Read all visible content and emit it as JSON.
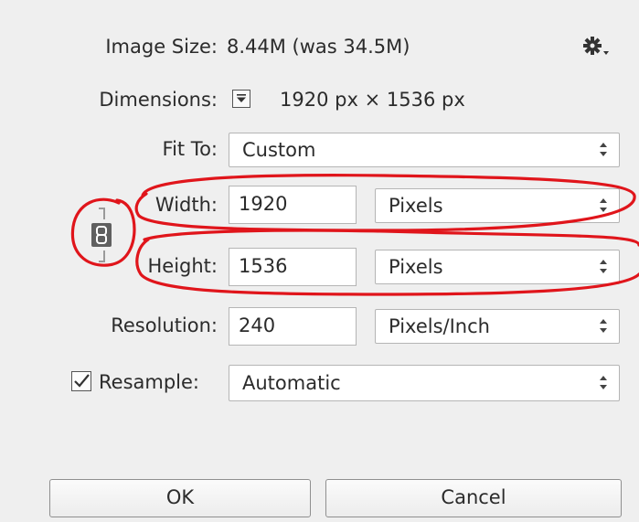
{
  "image_size": {
    "label": "Image Size:",
    "value": "8.44M (was 34.5M)"
  },
  "gear_icon": "gear-icon",
  "dimensions": {
    "label": "Dimensions:",
    "width_value": "1920",
    "width_unit": "px",
    "times": "×",
    "height_value": "1536",
    "height_unit": "px"
  },
  "fit_to": {
    "label": "Fit To:",
    "value": "Custom"
  },
  "width": {
    "label": "Width:",
    "value": "1920",
    "unit": "Pixels"
  },
  "height": {
    "label": "Height:",
    "value": "1536",
    "unit": "Pixels"
  },
  "resolution": {
    "label": "Resolution:",
    "value": "240",
    "unit": "Pixels/Inch"
  },
  "resample": {
    "label": "Resample:",
    "checked": true,
    "value": "Automatic"
  },
  "buttons": {
    "ok": "OK",
    "cancel": "Cancel"
  },
  "colors": {
    "annotation": "#e0151b",
    "background": "#efefef",
    "field_border": "#b5b5b5"
  }
}
